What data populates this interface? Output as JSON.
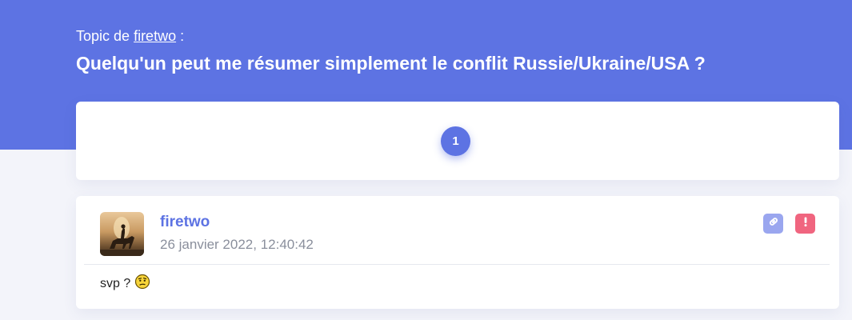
{
  "header": {
    "topic_prefix": "Topic de",
    "topic_author": "firetwo",
    "topic_suffix": ":",
    "title": "Quelqu'un peut me résumer simplement le conflit Russie/Ukraine/USA ?"
  },
  "pagination": {
    "current_page": "1"
  },
  "post": {
    "author": "firetwo",
    "date": "26 janvier 2022, 12:40:42",
    "message": "svp ?",
    "smiley_icon": "thinking-smiley-icon",
    "actions": [
      "link-icon",
      "report-icon"
    ]
  },
  "colors": {
    "accent": "#5d73e3",
    "link_button": "#9aa6ef",
    "report_button": "#f0657f",
    "background": "#f3f4fa"
  }
}
